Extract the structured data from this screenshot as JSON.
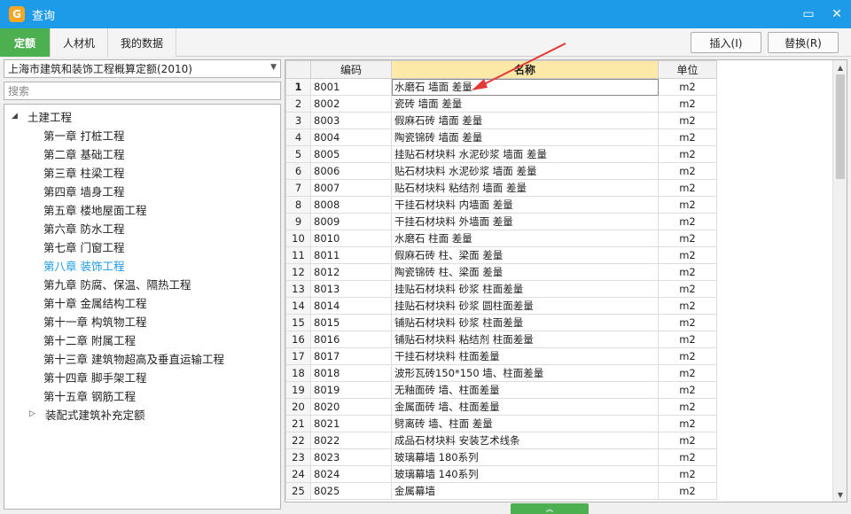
{
  "window": {
    "title": "查询",
    "icon": "G",
    "controls": {
      "minimize": "▭",
      "close": "✕"
    }
  },
  "tabs": [
    {
      "label": "定额",
      "active": true
    },
    {
      "label": "人材机",
      "active": false
    },
    {
      "label": "我的数据",
      "active": false
    }
  ],
  "actions": {
    "insert": "插入(I)",
    "replace": "替换(R)"
  },
  "left": {
    "combo_value": "上海市建筑和装饰工程概算定额(2010)",
    "search_placeholder": "搜索",
    "tree": [
      {
        "label": "土建工程",
        "level": 0,
        "toggle": "◢"
      },
      {
        "label": "第一章 打桩工程",
        "level": 1
      },
      {
        "label": "第二章 基础工程",
        "level": 1
      },
      {
        "label": "第三章 柱梁工程",
        "level": 1
      },
      {
        "label": "第四章 墙身工程",
        "level": 1
      },
      {
        "label": "第五章 楼地屋面工程",
        "level": 1
      },
      {
        "label": "第六章 防水工程",
        "level": 1
      },
      {
        "label": "第七章 门窗工程",
        "level": 1
      },
      {
        "label": "第八章 装饰工程",
        "level": 1,
        "selected": true
      },
      {
        "label": "第九章 防腐、保温、隔热工程",
        "level": 1
      },
      {
        "label": "第十章 金属结构工程",
        "level": 1
      },
      {
        "label": "第十一章 构筑物工程",
        "level": 1
      },
      {
        "label": "第十二章 附属工程",
        "level": 1
      },
      {
        "label": "第十三章 建筑物超高及垂直运输工程",
        "level": 1
      },
      {
        "label": "第十四章 脚手架工程",
        "level": 1
      },
      {
        "label": "第十五章 钢筋工程",
        "level": 1
      },
      {
        "label": "装配式建筑补充定额",
        "level": 0,
        "toggle": "▷"
      }
    ]
  },
  "grid": {
    "headers": {
      "rownum": "",
      "code": "编码",
      "name": "名称",
      "unit": "单位"
    },
    "rows": [
      {
        "n": "1",
        "code": "8001",
        "name": "水磨石 墙面 差量",
        "unit": "m2"
      },
      {
        "n": "2",
        "code": "8002",
        "name": "瓷砖 墙面 差量",
        "unit": "m2"
      },
      {
        "n": "3",
        "code": "8003",
        "name": "假麻石砖 墙面 差量",
        "unit": "m2"
      },
      {
        "n": "4",
        "code": "8004",
        "name": "陶瓷锦砖 墙面 差量",
        "unit": "m2"
      },
      {
        "n": "5",
        "code": "8005",
        "name": "挂贴石材块料 水泥砂浆 墙面 差量",
        "unit": "m2"
      },
      {
        "n": "6",
        "code": "8006",
        "name": "贴石材块料 水泥砂浆 墙面 差量",
        "unit": "m2"
      },
      {
        "n": "7",
        "code": "8007",
        "name": "贴石材块料 粘结剂 墙面 差量",
        "unit": "m2"
      },
      {
        "n": "8",
        "code": "8008",
        "name": "干挂石材块料 内墙面 差量",
        "unit": "m2"
      },
      {
        "n": "9",
        "code": "8009",
        "name": "干挂石材块料 外墙面 差量",
        "unit": "m2"
      },
      {
        "n": "10",
        "code": "8010",
        "name": "水磨石 柱面 差量",
        "unit": "m2"
      },
      {
        "n": "11",
        "code": "8011",
        "name": "假麻石砖 柱、梁面 差量",
        "unit": "m2"
      },
      {
        "n": "12",
        "code": "8012",
        "name": "陶瓷锦砖 柱、梁面 差量",
        "unit": "m2"
      },
      {
        "n": "13",
        "code": "8013",
        "name": "挂贴石材块料 砂浆 柱面差量",
        "unit": "m2"
      },
      {
        "n": "14",
        "code": "8014",
        "name": "挂贴石材块料 砂浆 圆柱面差量",
        "unit": "m2"
      },
      {
        "n": "15",
        "code": "8015",
        "name": "铺贴石材块料 砂浆 柱面差量",
        "unit": "m2"
      },
      {
        "n": "16",
        "code": "8016",
        "name": "铺贴石材块料 粘结剂 柱面差量",
        "unit": "m2"
      },
      {
        "n": "17",
        "code": "8017",
        "name": "干挂石材块料 柱面差量",
        "unit": "m2"
      },
      {
        "n": "18",
        "code": "8018",
        "name": "波形瓦砖150*150 墙、柱面差量",
        "unit": "m2"
      },
      {
        "n": "19",
        "code": "8019",
        "name": "无釉面砖 墙、柱面差量",
        "unit": "m2"
      },
      {
        "n": "20",
        "code": "8020",
        "name": "金属面砖 墙、柱面差量",
        "unit": "m2"
      },
      {
        "n": "21",
        "code": "8021",
        "name": "劈离砖 墙、柱面 差量",
        "unit": "m2"
      },
      {
        "n": "22",
        "code": "8022",
        "name": "成品石材块料 安装艺术线条",
        "unit": "m2"
      },
      {
        "n": "23",
        "code": "8023",
        "name": "玻璃幕墙 180系列",
        "unit": "m2"
      },
      {
        "n": "24",
        "code": "8024",
        "name": "玻璃幕墙 140系列",
        "unit": "m2"
      },
      {
        "n": "25",
        "code": "8025",
        "name": "金属幕墙",
        "unit": "m2"
      }
    ]
  },
  "colors": {
    "titlebar": "#1e9be8",
    "accent_green": "#4caf50",
    "selected_text": "#1e9be8",
    "arrow": "#e53935",
    "header_highlight": "#fce9a8"
  },
  "icons": {
    "scroll_up": "▲",
    "scroll_down": "▼",
    "combo_arrow": "▼",
    "handle": "︽"
  }
}
